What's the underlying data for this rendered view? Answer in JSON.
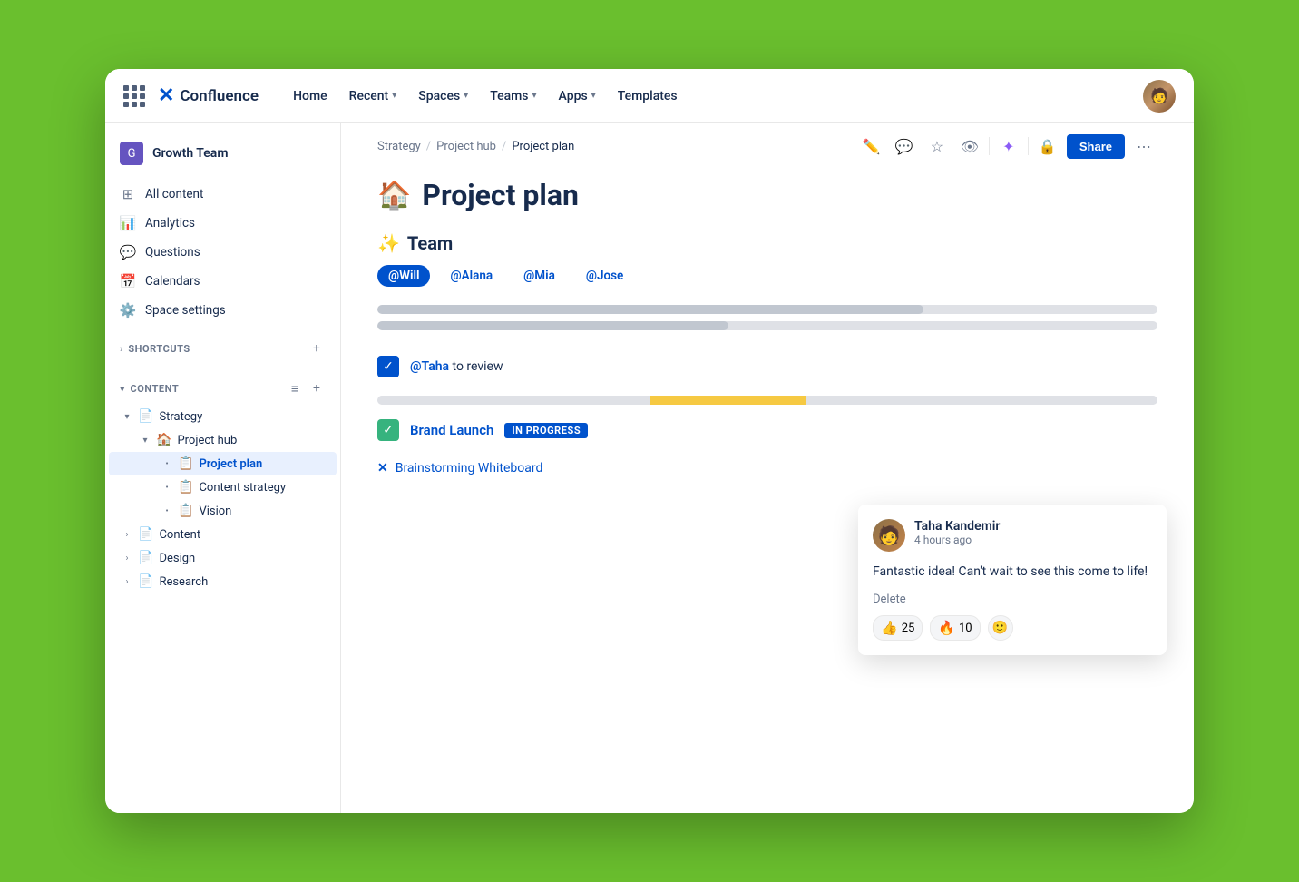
{
  "nav": {
    "grid_icon": "grid-icon",
    "logo_text": "Confluence",
    "links": [
      {
        "label": "Home",
        "has_chevron": false
      },
      {
        "label": "Recent",
        "has_chevron": true
      },
      {
        "label": "Spaces",
        "has_chevron": true
      },
      {
        "label": "Teams",
        "has_chevron": true
      },
      {
        "label": "Apps",
        "has_chevron": true
      },
      {
        "label": "Templates",
        "has_chevron": false
      }
    ]
  },
  "sidebar": {
    "space_name": "Growth Team",
    "items": [
      {
        "label": "All content",
        "icon": "🏠"
      },
      {
        "label": "Analytics",
        "icon": "📊"
      },
      {
        "label": "Questions",
        "icon": "💬"
      },
      {
        "label": "Calendars",
        "icon": "📅"
      },
      {
        "label": "Space settings",
        "icon": "⚙️"
      }
    ],
    "shortcuts_label": "SHORTCUTS",
    "content_label": "CONTENT",
    "tree": [
      {
        "label": "Strategy",
        "level": 0,
        "emoji": "📄",
        "expanded": true
      },
      {
        "label": "Project hub",
        "level": 1,
        "emoji": "🏠",
        "expanded": true
      },
      {
        "label": "Project plan",
        "level": 2,
        "emoji": "📋",
        "active": true
      },
      {
        "label": "Content strategy",
        "level": 2,
        "emoji": "📋"
      },
      {
        "label": "Vision",
        "level": 2,
        "emoji": "📋"
      },
      {
        "label": "Content",
        "level": 0,
        "emoji": "📄",
        "expanded": false
      },
      {
        "label": "Design",
        "level": 0,
        "emoji": "📄",
        "expanded": false
      },
      {
        "label": "Research",
        "level": 0,
        "emoji": "📄",
        "expanded": false
      }
    ]
  },
  "breadcrumb": {
    "items": [
      "Strategy",
      "Project hub",
      "Project plan"
    ]
  },
  "page": {
    "title_emoji": "🏠",
    "title": "Project plan",
    "sections": [
      {
        "type": "team",
        "heading_emoji": "✨",
        "heading": "Team",
        "mentions": [
          "@Will",
          "@Alana",
          "@Mia",
          "@Jose"
        ]
      }
    ],
    "progress_bars": [
      {
        "width": "70%"
      },
      {
        "width": "45%"
      }
    ],
    "task": {
      "checked": true,
      "mention": "@Taha",
      "text": " to review"
    },
    "partial_bar": {
      "grey_width": "35%",
      "yellow_start": "35%",
      "yellow_width": "20%"
    },
    "brand_launch": {
      "label": "Brand Launch",
      "status": "IN PROGRESS"
    },
    "whiteboard": {
      "label": "Brainstorming Whiteboard",
      "icon": "✕"
    }
  },
  "toolbar": {
    "edit_icon": "✏️",
    "comment_icon": "💬",
    "star_icon": "☆",
    "view_icon": "👁",
    "ai_icon": "✦",
    "lock_icon": "🔒",
    "share_label": "Share",
    "more_icon": "⋯"
  },
  "comment": {
    "author": "Taha Kandemir",
    "time": "4 hours ago",
    "text": "Fantastic idea! Can't wait to see this come to life!",
    "delete_label": "Delete",
    "reactions": [
      {
        "emoji": "👍",
        "count": 25
      },
      {
        "emoji": "🔥",
        "count": 10
      }
    ],
    "add_reaction_label": "😊"
  }
}
